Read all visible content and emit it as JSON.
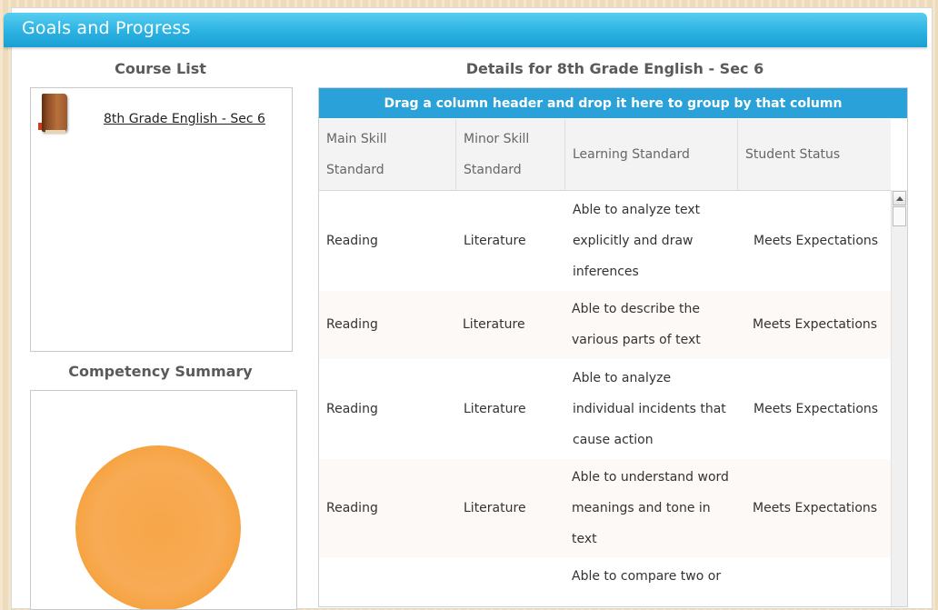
{
  "banner": {
    "title": "Goals and Progress"
  },
  "course_list": {
    "title": "Course List",
    "courses": [
      {
        "name": "8th Grade English - Sec 6",
        "icon": "book-icon"
      }
    ]
  },
  "competency": {
    "title": "Competency Summary",
    "pie_color": "#f7a442"
  },
  "details": {
    "title": "Details for 8th Grade English - Sec 6",
    "group_hint": "Drag a column header and drop it here to group by that column",
    "columns": [
      "Main Skill Standard",
      "Minor Skill Standard",
      "Learning Standard",
      "Student Status"
    ],
    "rows": [
      {
        "main": "Reading",
        "minor": "Literature",
        "learning": "Able to analyze text explicitly and draw inferences",
        "status": "Meets Expectations"
      },
      {
        "main": "Reading",
        "minor": "Literature",
        "learning": "Able to describe the various parts of text",
        "status": "Meets Expectations"
      },
      {
        "main": "Reading",
        "minor": "Literature",
        "learning": "Able to analyze individual incidents that cause action",
        "status": "Meets Expectations"
      },
      {
        "main": "Reading",
        "minor": "Literature",
        "learning": "Able to understand word meanings and tone in text",
        "status": "Meets Expectations"
      },
      {
        "main": "",
        "minor": "",
        "learning": "Able to compare two or",
        "status": ""
      }
    ]
  },
  "colors": {
    "banner": "#2ab2e2",
    "group_bar": "#2aa1d8",
    "pie": "#f7a442"
  }
}
